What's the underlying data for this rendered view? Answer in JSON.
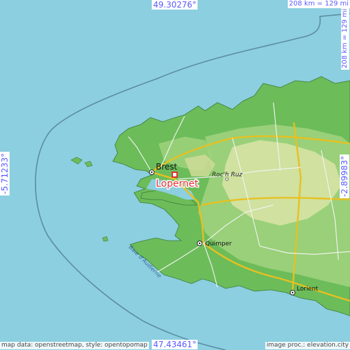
{
  "coords": {
    "top": "49.30276°",
    "bottom": "47.43461°",
    "left": "-5.71233°",
    "right": "-2.89983°"
  },
  "scale": {
    "top": "208 km = 129 mi",
    "right": "208 km = 129 mi"
  },
  "places": {
    "highlight": "Lopernet",
    "cities": [
      "Brest",
      "Quimper",
      "Lorient"
    ],
    "locality": "Roc'h Ruz",
    "water": "Baie d'Audierne"
  },
  "credits": {
    "left": "map data: openstreetmap, style: opentopomap",
    "right": "image proc.: elevation.city"
  },
  "colors": {
    "sea": "#8ccfe0",
    "lowland": "#6cbc5a",
    "midland": "#9fd27c",
    "upland": "#d6e2a4",
    "highlight": "#e03030",
    "coord_text": "#5a5aff"
  }
}
